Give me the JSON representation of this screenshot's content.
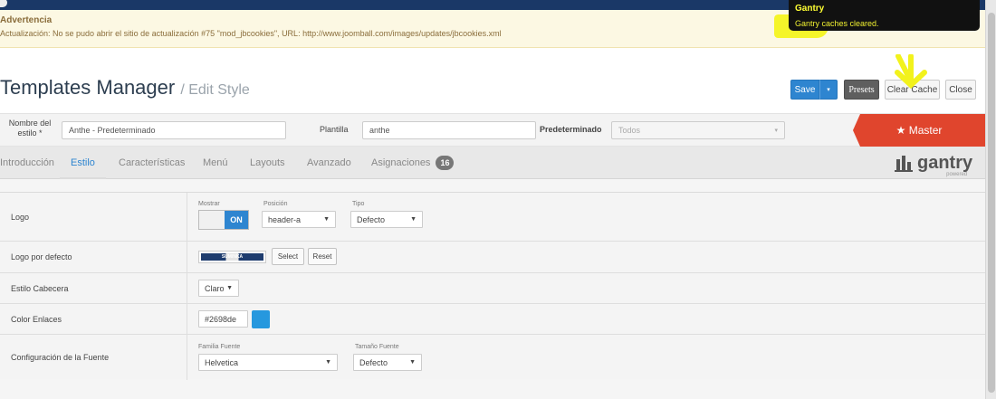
{
  "warning": {
    "title": "Advertencia",
    "message": "Actualización: No se pudo abrir el sitio de actualización #75 \"mod_jbcookies\", URL: http://www.joomball.com/images/updates/jbcookies.xml"
  },
  "toast": {
    "title": "Gantry",
    "message": "Gantry caches cleared."
  },
  "header": {
    "title": "Templates Manager",
    "subtitle": "/ Edit Style"
  },
  "toolbar": {
    "save": "Save",
    "save_dropdown": "▾",
    "presets": "Presets",
    "clear_cache": "Clear Cache",
    "close": "Close"
  },
  "style_bar": {
    "name_label": "Nombre del estilo *",
    "name_value": "Anthe - Predeterminado",
    "template_label": "Plantilla",
    "template_value": "anthe",
    "default_label": "Predeterminado",
    "default_value": "Todos",
    "master": "★ Master"
  },
  "tabs": [
    {
      "label": "Introducción"
    },
    {
      "label": "Estilo"
    },
    {
      "label": "Características"
    },
    {
      "label": "Menú"
    },
    {
      "label": "Layouts"
    },
    {
      "label": "Avanzado"
    },
    {
      "label": "Asignaciones",
      "badge": "16"
    }
  ],
  "active_tab": "Estilo",
  "brand": {
    "name": "gantry",
    "tagline": "powered"
  },
  "rows": {
    "logo": {
      "label": "Logo",
      "show_label": "Mostrar",
      "toggle_state": "ON",
      "position_label": "Posición",
      "position_value": "header-a",
      "type_label": "Tipo",
      "type_value": "Defecto"
    },
    "default_logo": {
      "label": "Logo por defecto",
      "thumb_text": "SUMINKA",
      "select": "Select",
      "reset": "Reset"
    },
    "header_style": {
      "label": "Estilo Cabecera",
      "value": "Claro"
    },
    "link_color": {
      "label": "Color Enlaces",
      "value": "#2698de",
      "swatch_color": "#2698de"
    },
    "font_config": {
      "label": "Configuración de la Fuente",
      "family_label": "Familia Fuente",
      "family_value": "Helvetica",
      "size_label": "Tamaño Fuente",
      "size_value": "Defecto"
    }
  },
  "colors": {
    "accent": "#2e85d0",
    "master": "#e0452d",
    "highlight": "#f5f52a"
  }
}
